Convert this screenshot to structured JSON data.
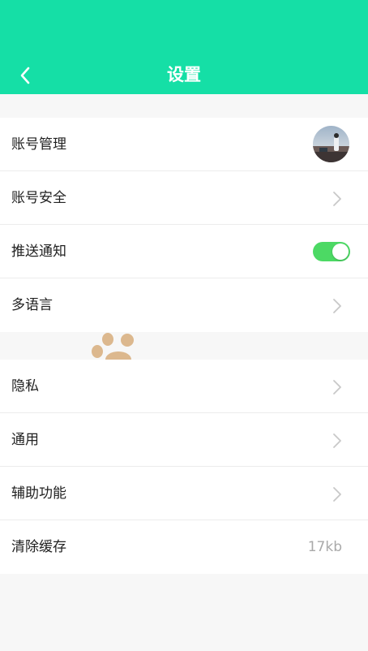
{
  "header": {
    "title": "设置",
    "back_icon": "chevron-left-icon",
    "background_color": "#15dfa6"
  },
  "settings": {
    "group1": [
      {
        "label": "账号管理",
        "type": "avatar"
      },
      {
        "label": "账号安全",
        "type": "chevron"
      },
      {
        "label": "推送通知",
        "type": "toggle",
        "enabled": true
      },
      {
        "label": "多语言",
        "type": "chevron"
      }
    ],
    "group2": [
      {
        "label": "隐私",
        "type": "chevron"
      },
      {
        "label": "通用",
        "type": "chevron"
      },
      {
        "label": "辅助功能",
        "type": "chevron"
      },
      {
        "label": "清除缓存",
        "type": "value",
        "value": "17kb"
      }
    ]
  },
  "colors": {
    "toggle_on": "#4cd964",
    "chevron": "#c8c8c8",
    "value_text": "#a9a9a9",
    "paw_decoration": "#dcb88e"
  }
}
